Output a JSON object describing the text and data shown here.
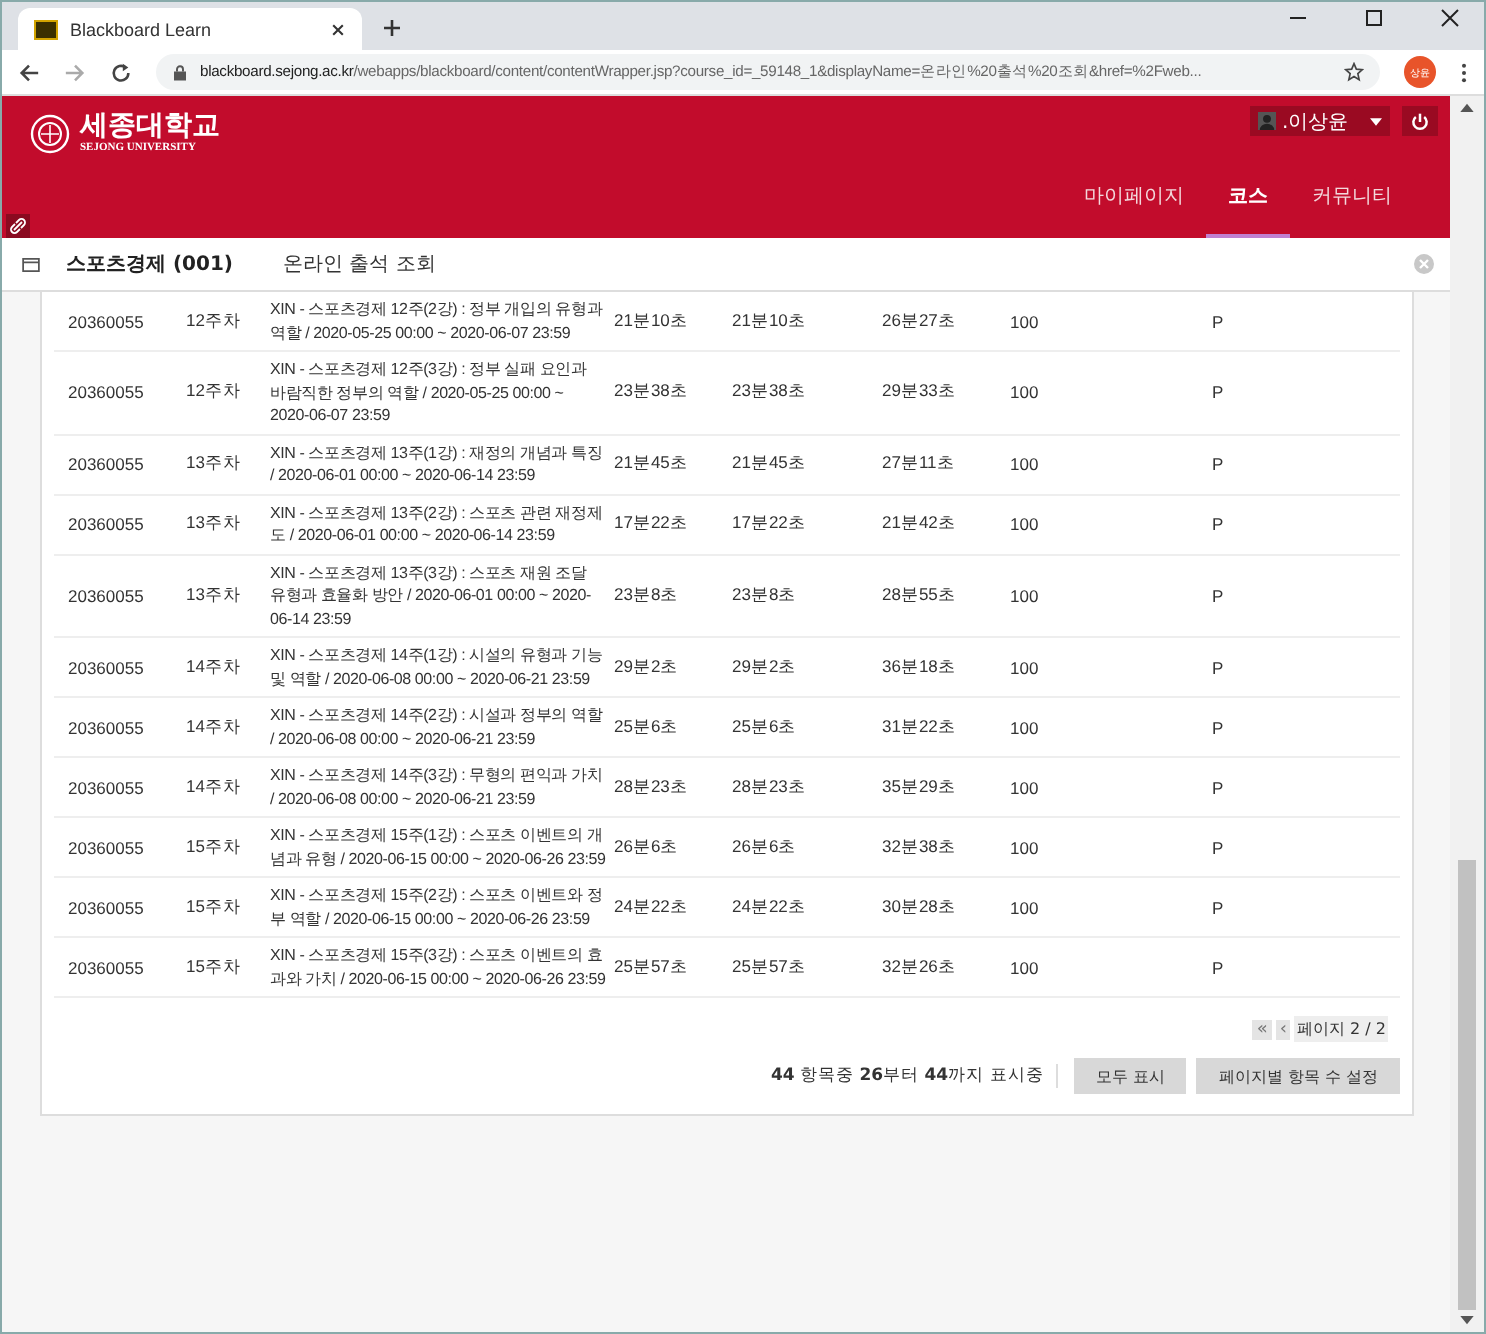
{
  "browser": {
    "tab_title": "Blackboard Learn",
    "url_host": "blackboard.sejong.ac.kr",
    "url_path": "/webapps/blackboard/content/contentWrapper.jsp?course_id=_59148_1&displayName=온라인%20출석%20조회&href=%2Fweb...",
    "profile": "상윤"
  },
  "header": {
    "logo_name": "세종대학교",
    "logo_sub": "SEJONG UNIVERSITY",
    "user": ".이상윤",
    "nav": [
      {
        "label": "마이페이지",
        "selected": false
      },
      {
        "label": "코스",
        "selected": true
      },
      {
        "label": "커뮤니티",
        "selected": false
      }
    ]
  },
  "breadcrumb": {
    "course": "스포츠경제 (001)",
    "page": "온라인 출석 조회"
  },
  "table": {
    "rows": [
      {
        "id": "20360055",
        "week": "12주차",
        "title": "XIN - 스포츠경제 12주(2강) : 정부 개입의 유형과 역할 / 2020-05-25 00:00 ~ 2020-06-07 23:59",
        "time_1": "21분10초",
        "time_2": "21분10초",
        "time_3": "26분27초",
        "score": "100",
        "result": "P"
      },
      {
        "id": "20360055",
        "week": "12주차",
        "title": "XIN - 스포츠경제 12주(3강) : 정부 실패 요인과 바람직한 정부의 역할 / 2020-05-25 00:00 ~ 2020-06-07 23:59",
        "time_1": "23분38초",
        "time_2": "23분38초",
        "time_3": "29분33초",
        "score": "100",
        "result": "P"
      },
      {
        "id": "20360055",
        "week": "13주차",
        "title": "XIN - 스포츠경제 13주(1강) : 재정의 개념과 특징 / 2020-06-01 00:00 ~ 2020-06-14 23:59",
        "time_1": "21분45초",
        "time_2": "21분45초",
        "time_3": "27분11초",
        "score": "100",
        "result": "P"
      },
      {
        "id": "20360055",
        "week": "13주차",
        "title": "XIN - 스포츠경제 13주(2강) : 스포츠 관련 재정제도 / 2020-06-01 00:00 ~ 2020-06-14 23:59",
        "time_1": "17분22초",
        "time_2": "17분22초",
        "time_3": "21분42초",
        "score": "100",
        "result": "P"
      },
      {
        "id": "20360055",
        "week": "13주차",
        "title": "XIN - 스포츠경제 13주(3강) : 스포츠 재원 조달 유형과 효율화 방안 / 2020-06-01 00:00 ~ 2020-06-14 23:59",
        "time_1": "23분8초",
        "time_2": "23분8초",
        "time_3": "28분55초",
        "score": "100",
        "result": "P"
      },
      {
        "id": "20360055",
        "week": "14주차",
        "title": "XIN - 스포츠경제 14주(1강) : 시설의 유형과 기능 및 역할 / 2020-06-08 00:00 ~ 2020-06-21 23:59",
        "time_1": "29분2초",
        "time_2": "29분2초",
        "time_3": "36분18초",
        "score": "100",
        "result": "P"
      },
      {
        "id": "20360055",
        "week": "14주차",
        "title": "XIN - 스포츠경제 14주(2강) : 시설과 정부의 역할 / 2020-06-08 00:00 ~ 2020-06-21 23:59",
        "time_1": "25분6초",
        "time_2": "25분6초",
        "time_3": "31분22초",
        "score": "100",
        "result": "P"
      },
      {
        "id": "20360055",
        "week": "14주차",
        "title": "XIN - 스포츠경제 14주(3강) : 무형의 편익과 가치 / 2020-06-08 00:00 ~ 2020-06-21 23:59",
        "time_1": "28분23초",
        "time_2": "28분23초",
        "time_3": "35분29초",
        "score": "100",
        "result": "P"
      },
      {
        "id": "20360055",
        "week": "15주차",
        "title": "XIN - 스포츠경제 15주(1강) : 스포츠 이벤트의 개념과 유형 / 2020-06-15 00:00 ~ 2020-06-26 23:59",
        "time_1": "26분6초",
        "time_2": "26분6초",
        "time_3": "32분38초",
        "score": "100",
        "result": "P"
      },
      {
        "id": "20360055",
        "week": "15주차",
        "title": "XIN - 스포츠경제 15주(2강) : 스포츠 이벤트와 정부 역할 / 2020-06-15 00:00 ~ 2020-06-26 23:59",
        "time_1": "24분22초",
        "time_2": "24분22초",
        "time_3": "30분28초",
        "score": "100",
        "result": "P"
      },
      {
        "id": "20360055",
        "week": "15주차",
        "title": "XIN - 스포츠경제 15주(3강) : 스포츠 이벤트의 효과와 가치 / 2020-06-15 00:00 ~ 2020-06-26 23:59",
        "time_1": "25분57초",
        "time_2": "25분57초",
        "time_3": "32분26초",
        "score": "100",
        "result": "P"
      }
    ]
  },
  "pagination": {
    "first": "«",
    "prev": "‹",
    "page": "페이지 2 / 2"
  },
  "footer": {
    "count": "**44** 항목중 **26**부터 **44**까지 표시중",
    "buttons": [
      "모두 표시",
      "페이지별 항목 수 설정"
    ]
  }
}
